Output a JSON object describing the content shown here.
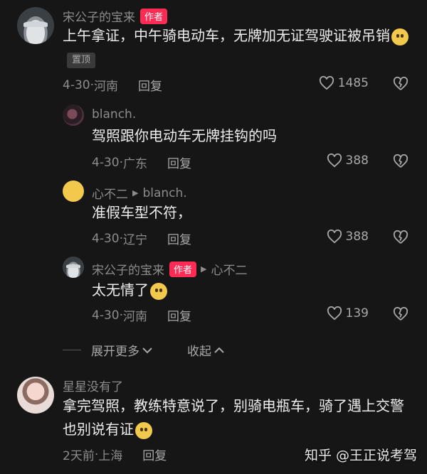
{
  "comments": [
    {
      "author": "宋公子的宝来",
      "badge": "作者",
      "text": "上午拿证，中午骑电动车，无牌加无证驾驶证被吊销",
      "pin": "置顶",
      "date": "4-30",
      "location": "河南",
      "reply_label": "回复",
      "likes": "1485"
    },
    {
      "author": "blanch.",
      "text": "驾照跟你电动车无牌挂钩的吗",
      "date": "4-30",
      "location": "广东",
      "reply_label": "回复",
      "likes": "388"
    },
    {
      "author": "心不二",
      "reply_to": "blanch.",
      "text": "准假车型不符，",
      "date": "4-30",
      "location": "辽宁",
      "reply_label": "回复",
      "likes": "388"
    },
    {
      "author": "宋公子的宝来",
      "badge": "作者",
      "reply_to": "心不二",
      "text": "太无情了",
      "date": "4-30",
      "location": "河南",
      "reply_label": "回复",
      "likes": "139"
    },
    {
      "author": "星星没有了",
      "text": "拿完驾照，教练特意说了，别骑电瓶车，骑了遇上交警也别说有证",
      "date": "2天前",
      "location": "上海",
      "reply_label": "回复"
    }
  ],
  "thread": {
    "expand_label": "展开更多",
    "collapse_label": "收起"
  },
  "watermark": "知乎 @王正说考驾",
  "icons": {
    "like": "heart-icon",
    "dislike": "broken-heart-icon",
    "expand": "chevron-down-icon",
    "collapse": "chevron-up-icon",
    "reply_arrow": "triangle-right-icon"
  },
  "colors": {
    "background": "#161616",
    "badge": "#fe2c55",
    "muted_text": "#8c8c8c"
  }
}
